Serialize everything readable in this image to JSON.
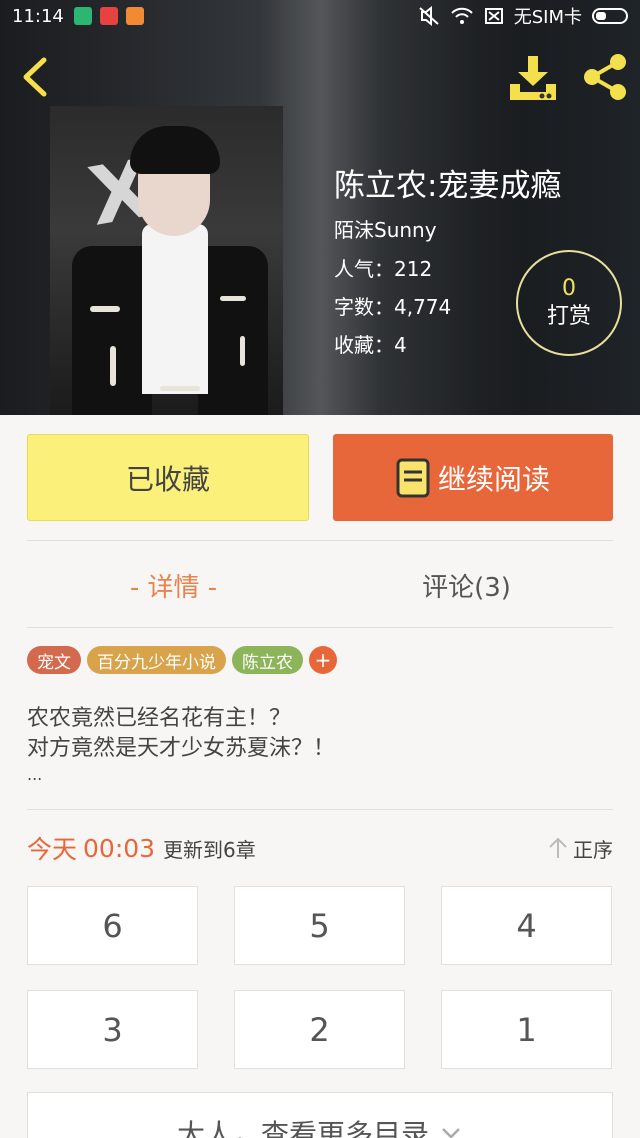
{
  "status_bar": {
    "time": "11:14",
    "sim_text": "无SIM卡"
  },
  "book": {
    "title": "陈立农:宠妻成瘾",
    "author": "陌沫Sunny",
    "popularity": "人气：212",
    "word_count": "字数：4,774",
    "favorites": "收藏：4"
  },
  "tip": {
    "count": "0",
    "label": "打赏"
  },
  "actions": {
    "collected_label": "已收藏",
    "continue_label": "继续阅读"
  },
  "tabs": {
    "detail": "- 详情 -",
    "comments": "评论(3)"
  },
  "tags": [
    {
      "label": "宠文",
      "color": "#d46a4d"
    },
    {
      "label": "百分九少年小说",
      "color": "#d8a34a"
    },
    {
      "label": "陈立农",
      "color": "#8cb55a"
    }
  ],
  "tag_add": "+",
  "description": {
    "line1": "农农竟然已经名花有主！？",
    "line2": "对方竟然是天才少女苏夏沫？！",
    "line3": "..."
  },
  "update": {
    "today": "今天",
    "time": "00:03",
    "text": "更新到6章",
    "sort_label": "正序"
  },
  "chapters": [
    "6",
    "5",
    "4",
    "3",
    "2",
    "1"
  ],
  "more_catalog": "大人，查看更多目录",
  "colors": {
    "accent": "#e8673a",
    "collected_bg": "#fbf07a",
    "tip_count": "#f4e25a",
    "icon_yellow": "#f4e04d"
  }
}
